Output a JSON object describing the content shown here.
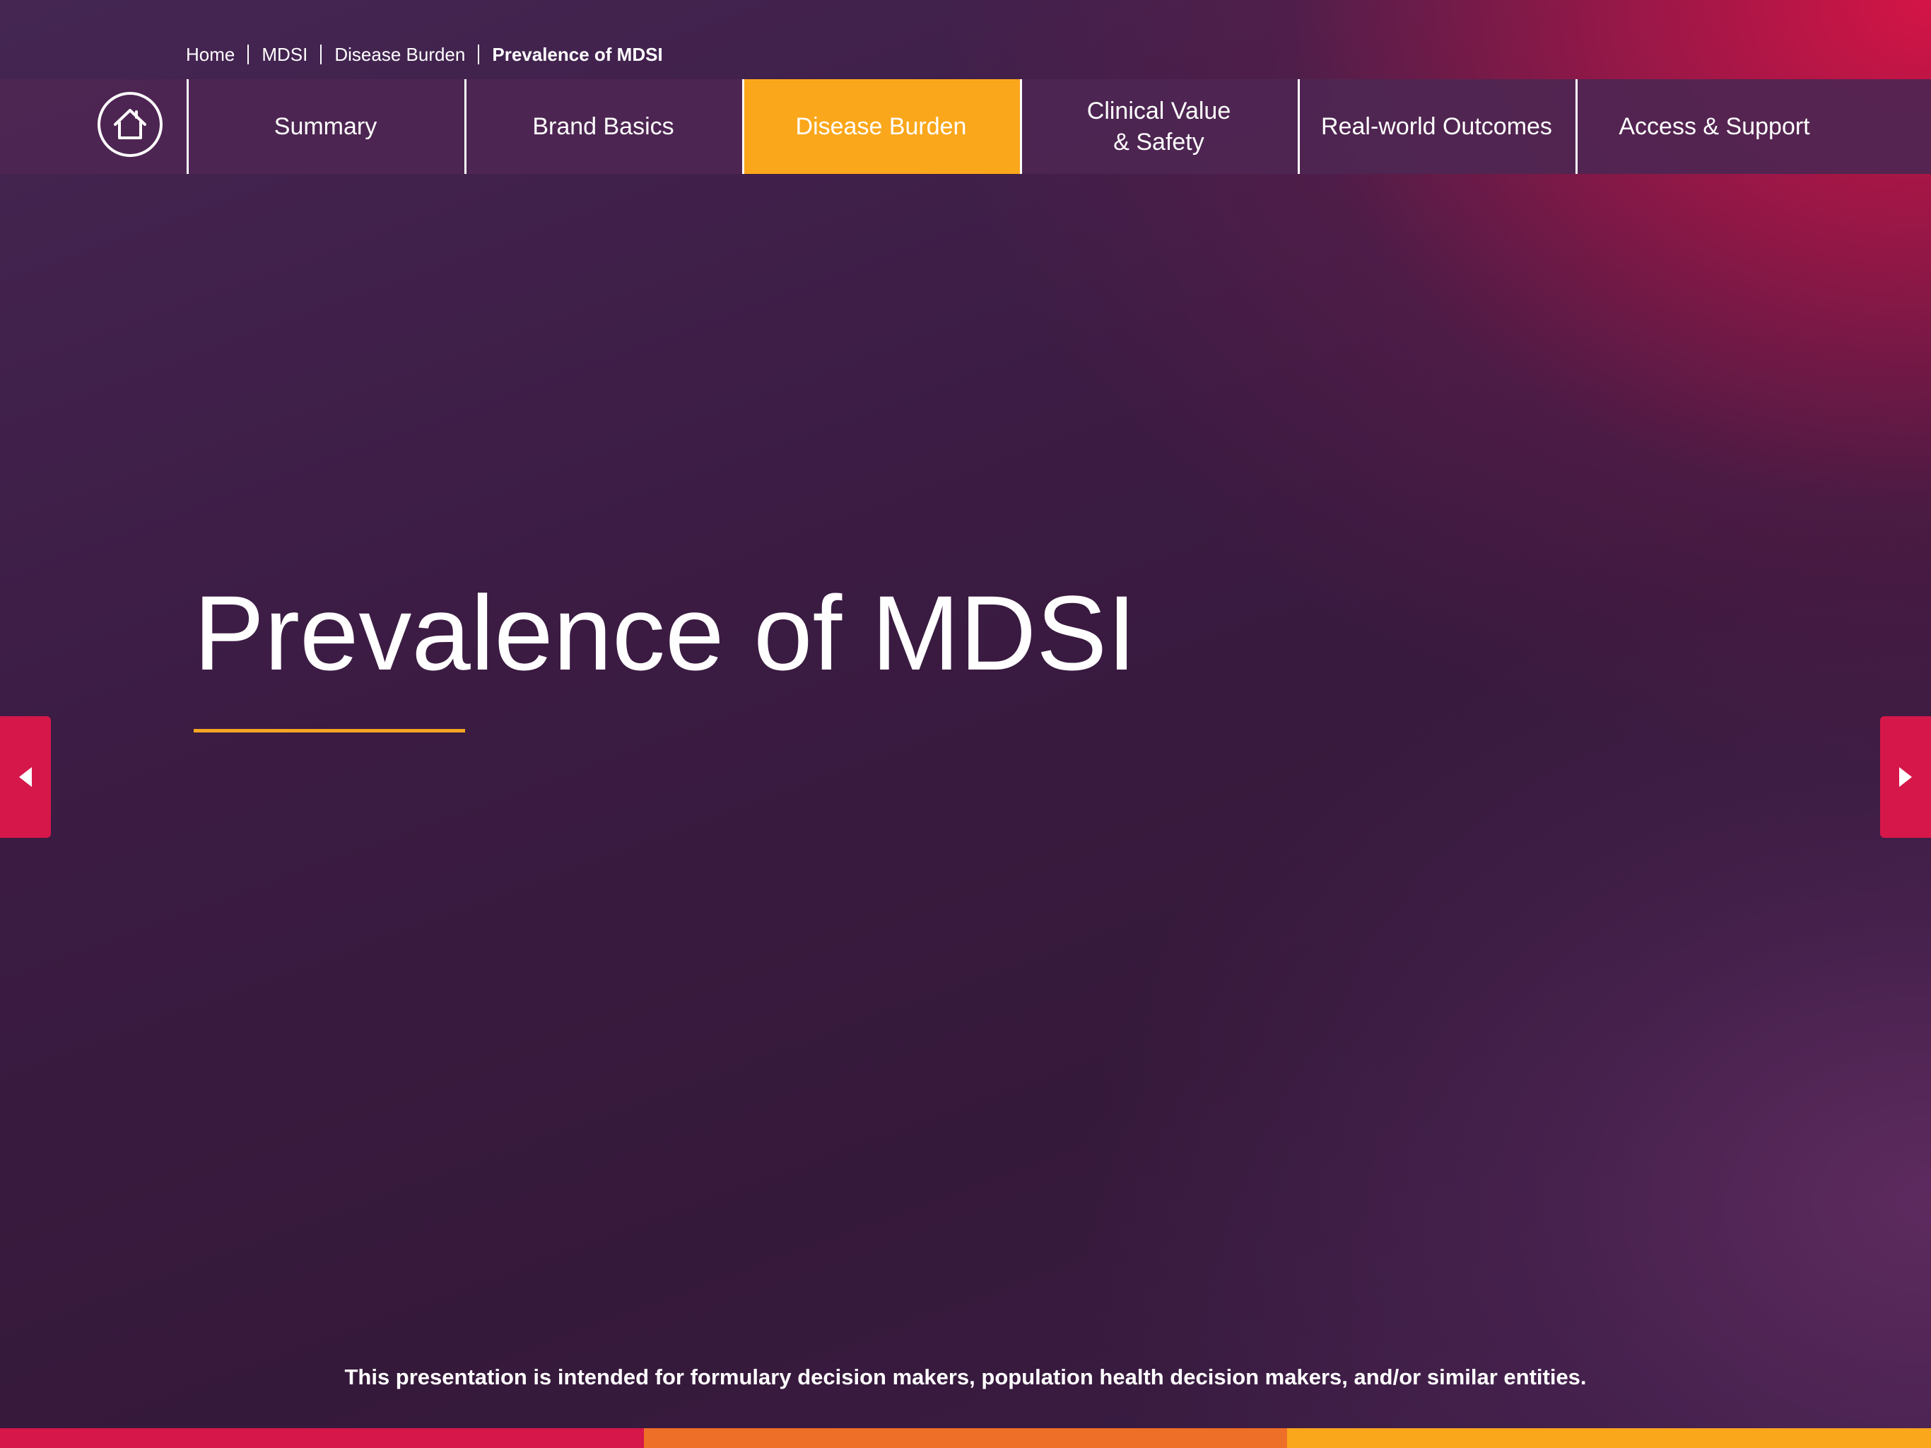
{
  "breadcrumb": {
    "items": [
      "Home",
      "MDSI",
      "Disease Burden"
    ],
    "current": "Prevalence of MDSI"
  },
  "nav": {
    "home_icon": "home-icon",
    "items": [
      {
        "label": "Summary",
        "active": false
      },
      {
        "label": "Brand Basics",
        "active": false
      },
      {
        "label": "Disease Burden",
        "active": true
      },
      {
        "label": "Clinical Value\n& Safety",
        "active": false
      },
      {
        "label": "Real-world Outcomes",
        "active": false
      },
      {
        "label": "Access & Support",
        "active": false
      }
    ]
  },
  "main": {
    "title": "Prevalence of MDSI"
  },
  "arrows": {
    "prev_icon": "caret-left-icon",
    "next_icon": "caret-right-icon"
  },
  "footer": {
    "disclaimer": "This presentation is intended for formulary decision makers, population health decision makers, and/or similar entities."
  },
  "colors": {
    "accent_orange": "#fba71b",
    "accent_red": "#d6174a",
    "bottom_bar": [
      "#d6174a",
      "#ee6f28",
      "#fba71b"
    ]
  }
}
